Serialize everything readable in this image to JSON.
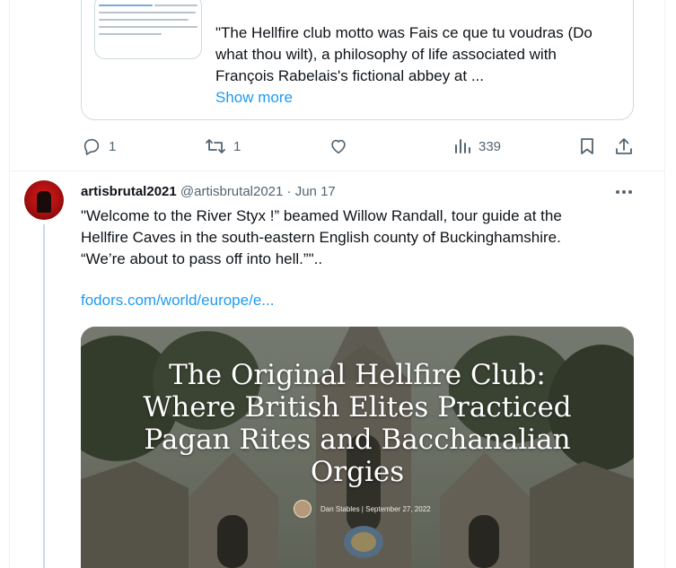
{
  "quoted": {
    "text": "\"The Hellfire club motto was Fais ce que tu voudras (Do what thou wilt), a philosophy of life associated with François Rabelais's fictional abbey at ...",
    "show_more": "Show more"
  },
  "actions": {
    "replies": "1",
    "reposts": "1",
    "views": "339"
  },
  "tweet": {
    "display_name": "artisbrutal2021",
    "handle": "@artisbrutal2021",
    "sep": "·",
    "date": "Jun 17",
    "text_line1": "\"Welcome to the River Styx !” beamed Willow Randall, tour guide at the",
    "text_line2": "Hellfire Caves in the south-eastern English county of Buckinghamshire.",
    "text_line3": "“We’re about to pass off into hell.”\"..",
    "link": "fodors.com/world/europe/e..."
  },
  "media": {
    "title_line1": "The Original Hellfire Club:",
    "title_line2": "Where British Elites Practiced",
    "title_line3": "Pagan Rites and Bacchanalian",
    "title_line4": "Orgies",
    "byline": "Dan Stables | September 27, 2022"
  },
  "colors": {
    "accent": "#1d9bf0",
    "muted": "#536471",
    "border": "#cfd9de"
  },
  "icons": [
    "reply-icon",
    "repost-icon",
    "like-icon",
    "views-icon",
    "bookmark-icon",
    "share-icon",
    "more-icon"
  ]
}
